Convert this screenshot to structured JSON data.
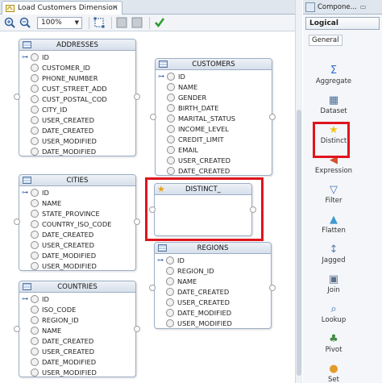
{
  "editor": {
    "tab_title": "Load Customers Dimension",
    "close_glyph": "×",
    "zoom": "100%"
  },
  "tables": {
    "addresses": {
      "name": "ADDRESSES",
      "rows": [
        "ID",
        "CUSTOMER_ID",
        "PHONE_NUMBER",
        "CUST_STREET_ADD",
        "CUST_POSTAL_COD",
        "CITY_ID",
        "USER_CREATED",
        "DATE_CREATED",
        "USER_MODIFIED",
        "DATE_MODIFIED"
      ]
    },
    "customers": {
      "name": "CUSTOMERS",
      "rows": [
        "ID",
        "NAME",
        "GENDER",
        "BIRTH_DATE",
        "MARITAL_STATUS",
        "INCOME_LEVEL",
        "CREDIT_LIMIT",
        "EMAIL",
        "USER_CREATED",
        "DATE_CREATED"
      ]
    },
    "cities": {
      "name": "CITIES",
      "rows": [
        "ID",
        "NAME",
        "STATE_PROVINCE",
        "COUNTRY_ISO_CODE",
        "DATE_CREATED",
        "USER_CREATED",
        "DATE_MODIFIED",
        "USER_MODIFIED"
      ]
    },
    "distinct": {
      "name": "DISTINCT_"
    },
    "regions": {
      "name": "REGIONS",
      "rows": [
        "ID",
        "REGION_ID",
        "NAME",
        "DATE_CREATED",
        "USER_CREATED",
        "DATE_MODIFIED",
        "USER_MODIFIED"
      ]
    },
    "countries": {
      "name": "COUNTRIES",
      "rows": [
        "ID",
        "ISO_CODE",
        "REGION_ID",
        "NAME",
        "DATE_CREATED",
        "USER_CREATED",
        "DATE_MODIFIED",
        "USER_MODIFIED"
      ]
    }
  },
  "palette": {
    "title": "Compone...",
    "category": "Logical",
    "group": "General",
    "items": [
      {
        "label": "Aggregate",
        "icon": "sigma-icon",
        "glyph": "Σ",
        "color": "#2c6fd1"
      },
      {
        "label": "Dataset",
        "icon": "dataset-icon",
        "glyph": "▦",
        "color": "#4a6d99"
      },
      {
        "label": "Distinct",
        "icon": "star-icon",
        "glyph": "★",
        "color": "#f0c419"
      },
      {
        "label": "Expression",
        "icon": "expression-icon",
        "glyph": "◀",
        "color": "#d2522c"
      },
      {
        "label": "Filter",
        "icon": "funnel-icon",
        "glyph": "▽",
        "color": "#4a78b8"
      },
      {
        "label": "Flatten",
        "icon": "flatten-icon",
        "glyph": "▲",
        "color": "#3d9bcf"
      },
      {
        "label": "Jagged",
        "icon": "jagged-icon",
        "glyph": "↕",
        "color": "#5a7fa8"
      },
      {
        "label": "Join",
        "icon": "join-icon",
        "glyph": "▣",
        "color": "#5a6f8a"
      },
      {
        "label": "Lookup",
        "icon": "lookup-icon",
        "glyph": "⌕",
        "color": "#3a6fb0"
      },
      {
        "label": "Pivot",
        "icon": "pivot-icon",
        "glyph": "♣",
        "color": "#3f8a3f"
      },
      {
        "label": "Set",
        "icon": "set-icon",
        "glyph": "●",
        "color": "#e39b2a"
      }
    ]
  },
  "colors": {
    "highlight": "#e0141e",
    "accent": "#2c5aa0"
  }
}
